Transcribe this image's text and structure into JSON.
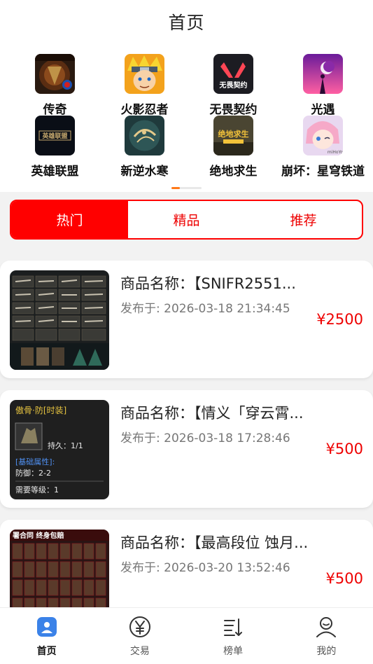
{
  "header": {
    "title": "首页"
  },
  "games": [
    {
      "label": "传奇",
      "icon": "legend-game-icon"
    },
    {
      "label": "火影忍者",
      "icon": "naruto-game-icon"
    },
    {
      "label": "无畏契约",
      "icon": "valorant-game-icon"
    },
    {
      "label": "光遇",
      "icon": "sky-game-icon"
    },
    {
      "label": "英雄联盟",
      "icon": "league-of-legends-game-icon"
    },
    {
      "label": "新逆水寒",
      "icon": "nishuihan-game-icon"
    },
    {
      "label": "绝地求生",
      "icon": "pubg-game-icon"
    },
    {
      "label": "崩坏：星穹铁道",
      "icon": "honkai-star-rail-game-icon"
    }
  ],
  "game_icon_texts": {
    "valorant": "无畏契约",
    "lol": "英雄联盟",
    "pubg": "绝地求生",
    "honkai": "miHoYo"
  },
  "tabs": [
    {
      "label": "热门",
      "active": true
    },
    {
      "label": "精品",
      "active": false
    },
    {
      "label": "推荐",
      "active": false
    }
  ],
  "products": [
    {
      "name": "商品名称：【SNIFR2551...",
      "date": "发布于: 2026-03-18 21:34:45",
      "price": "¥2500"
    },
    {
      "name": "商品名称：【情义「穿云霄...",
      "date": "发布于: 2026-03-18 17:28:46",
      "price": "¥500"
    },
    {
      "name": "商品名称：【最高段位 蚀月...",
      "date": "发布于: 2026-03-20 13:52:46",
      "price": "¥500"
    }
  ],
  "thumb_texts": {
    "item_title": "傲骨·防[时装]",
    "durability": "持久：1/1",
    "base_attr": "[基础属性]:",
    "defense": "防御：2-2",
    "level": "需要等级：1",
    "banner": "署合同 终身包赔"
  },
  "tabbar": [
    {
      "label": "首页",
      "icon": "home-icon",
      "active": true
    },
    {
      "label": "交易",
      "icon": "yuan-coin-icon",
      "active": false
    },
    {
      "label": "榜单",
      "icon": "ranking-list-icon",
      "active": false
    },
    {
      "label": "我的",
      "icon": "user-profile-icon",
      "active": false
    }
  ],
  "colors": {
    "accent": "#ff0000",
    "price": "#e00000",
    "tabbar_active": "#2b6fe0",
    "pager_active": "#ff7a1a"
  }
}
